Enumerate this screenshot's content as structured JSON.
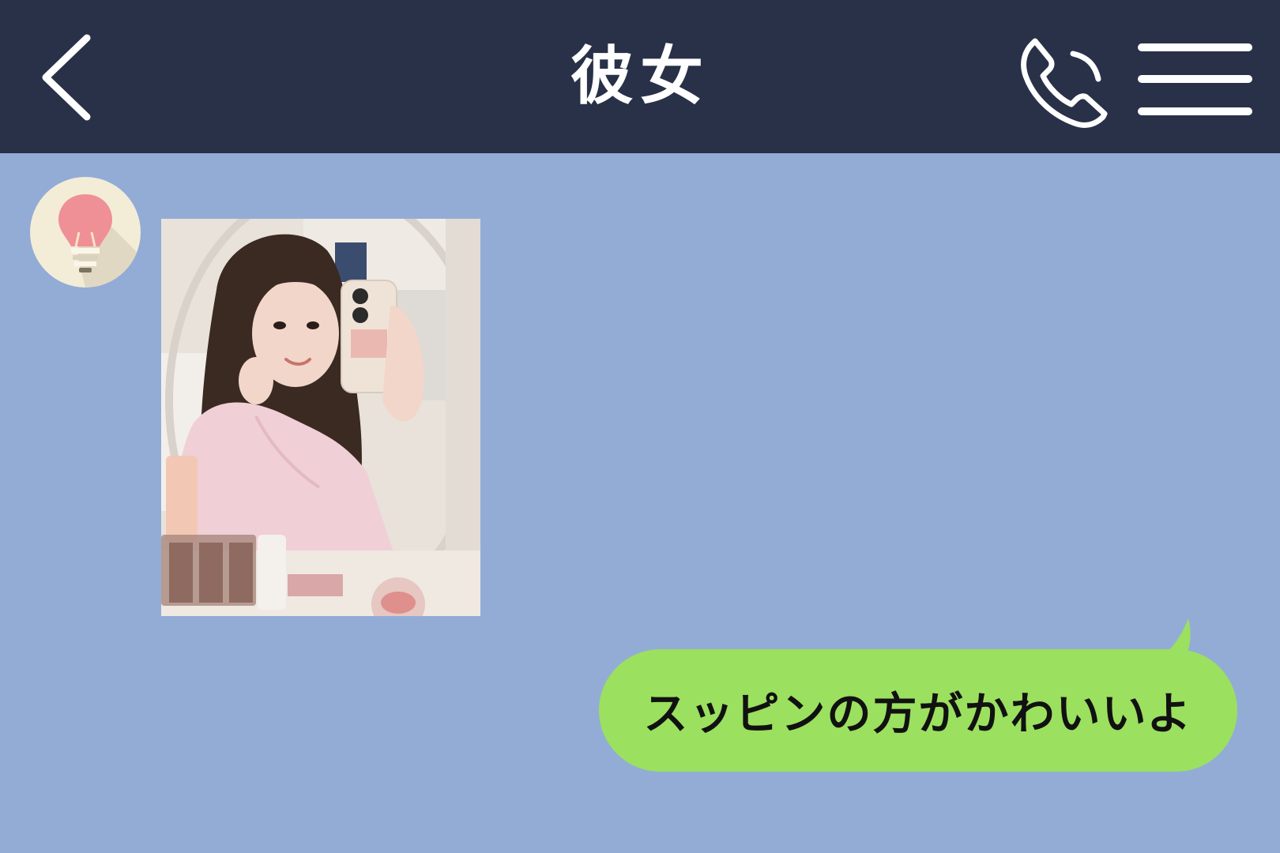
{
  "header": {
    "title": "彼女",
    "background": "#283148",
    "back_icon": "chevron-left-icon",
    "call_icon": "phone-icon",
    "menu_icon": "hamburger-menu-icon"
  },
  "chat": {
    "background": "#93acd6",
    "incoming": {
      "avatar_icon": "lightbulb-icon",
      "message_type": "photo"
    },
    "outgoing": {
      "text": "スッピンの方がかわいいよ",
      "bubble_color": "#9be05f"
    }
  }
}
